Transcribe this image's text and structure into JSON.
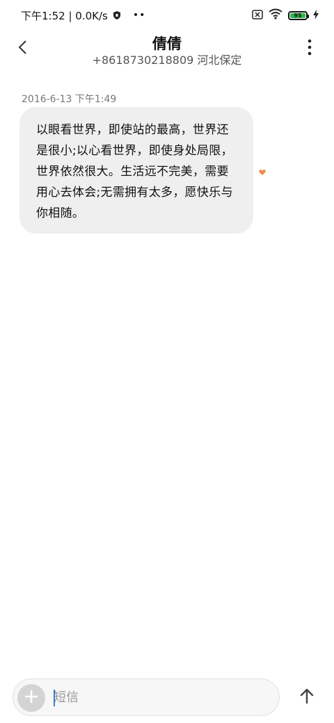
{
  "status_bar": {
    "time": "下午1:52",
    "network_speed": "0.0K/s",
    "left_text": "下午1:52 | 0.0K/s",
    "dots": "••",
    "battery_level": "95",
    "icons": [
      "vpn-shield-icon",
      "sim-off-icon",
      "wifi-icon",
      "battery-icon",
      "charging-bolt-icon"
    ]
  },
  "header": {
    "title": "倩倩",
    "subtitle": "+8618730218809 河北保定",
    "back_icon": "chevron-left-icon",
    "more_icon": "more-vertical-icon"
  },
  "conversation": {
    "messages": [
      {
        "timestamp": "2016-6-13 下午1:49",
        "text": "以眼看世界，即使站的最高，世界还是很小;以心看世界，即使身处局限，世界依然很大。生活远不完美，需要用心去体会;无需拥有太多，愿快乐与你相随。",
        "favorite_icon": "heart-icon",
        "favorite_color": "#f08a4b"
      }
    ]
  },
  "composer": {
    "placeholder": "短信",
    "value": "",
    "add_icon": "plus-icon",
    "send_icon": "arrow-up-icon",
    "caret_color": "#3a7bd5"
  }
}
